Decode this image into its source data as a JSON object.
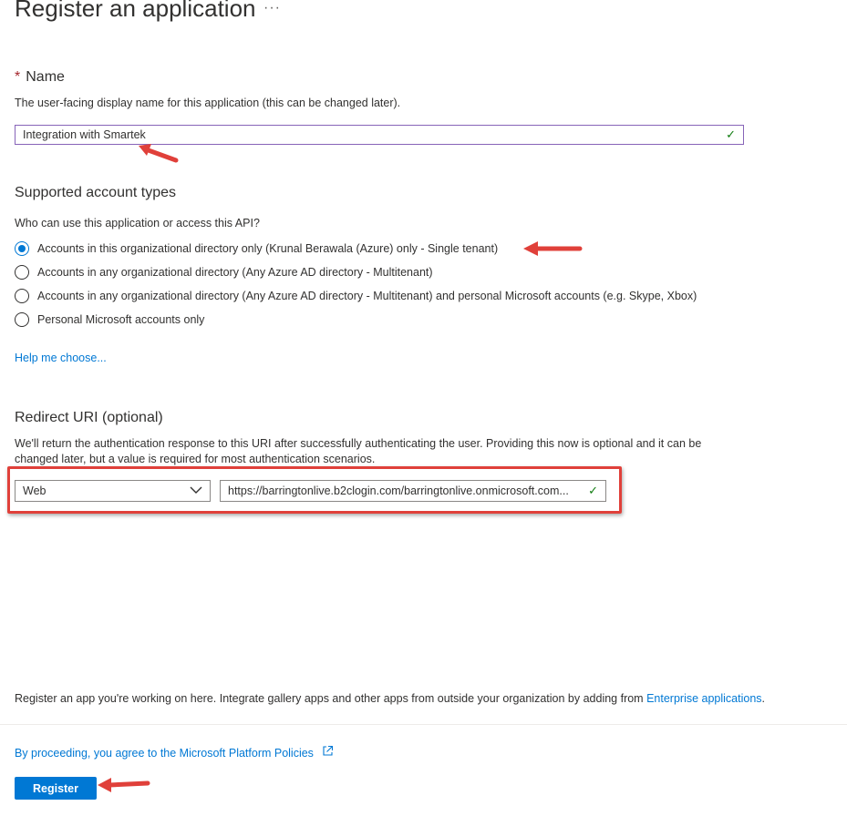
{
  "page": {
    "title": "Register an application",
    "more_label": "···"
  },
  "name_section": {
    "required_mark": "*",
    "heading": "Name",
    "description": "The user-facing display name for this application (this can be changed later).",
    "value": "Integration with Smartek"
  },
  "account_types": {
    "heading": "Supported account types",
    "question": "Who can use this application or access this API?",
    "options": [
      {
        "label": "Accounts in this organizational directory only (Krunal Berawala (Azure) only - Single tenant)",
        "selected": true
      },
      {
        "label": "Accounts in any organizational directory (Any Azure AD directory - Multitenant)",
        "selected": false
      },
      {
        "label": "Accounts in any organizational directory (Any Azure AD directory - Multitenant) and personal Microsoft accounts (e.g. Skype, Xbox)",
        "selected": false
      },
      {
        "label": "Personal Microsoft accounts only",
        "selected": false
      }
    ],
    "help_link": "Help me choose..."
  },
  "redirect": {
    "heading": "Redirect URI (optional)",
    "description_line1": "We'll return the authentication response to this URI after successfully authenticating the user. Providing this now is optional and it can be",
    "description_line2": "changed later, but a value is required for most authentication scenarios.",
    "platform_value": "Web",
    "uri_value": "https://barringtonlive.b2clogin.com/barringtonlive.onmicrosoft.com..."
  },
  "footer": {
    "note_text": "Register an app you're working on here. Integrate gallery apps and other apps from outside your organization by adding from ",
    "note_link": "Enterprise applications",
    "note_end": ".",
    "policy_link": "By proceeding, you agree to the Microsoft Platform Policies",
    "register_label": "Register"
  },
  "colors": {
    "accent": "#0078d4",
    "annotation_arrow": "#e0403a",
    "valid_check": "#107c10",
    "required": "#a4262c"
  },
  "icons": {
    "valid": "check-icon",
    "dropdown": "chevron-down-icon",
    "external": "external-link-icon"
  }
}
